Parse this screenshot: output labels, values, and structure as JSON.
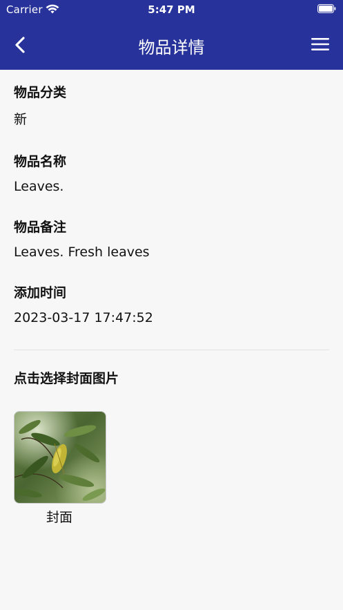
{
  "status_bar": {
    "carrier": "Carrier",
    "time": "5:47 PM"
  },
  "nav": {
    "title": "物品详情",
    "back_icon": "chevron-left-icon",
    "menu_icon": "hamburger-menu-icon"
  },
  "fields": [
    {
      "label": "物品分类",
      "value": "新"
    },
    {
      "label": "物品名称",
      "value": "Leaves."
    },
    {
      "label": "物品备注",
      "value": "Leaves. Fresh leaves"
    },
    {
      "label": "添加时间",
      "value": "2023-03-17 17:47:52"
    }
  ],
  "cover": {
    "heading": "点击选择封面图片",
    "caption": "封面"
  },
  "colors": {
    "header": "#27339a",
    "background": "#f7f7f7"
  }
}
